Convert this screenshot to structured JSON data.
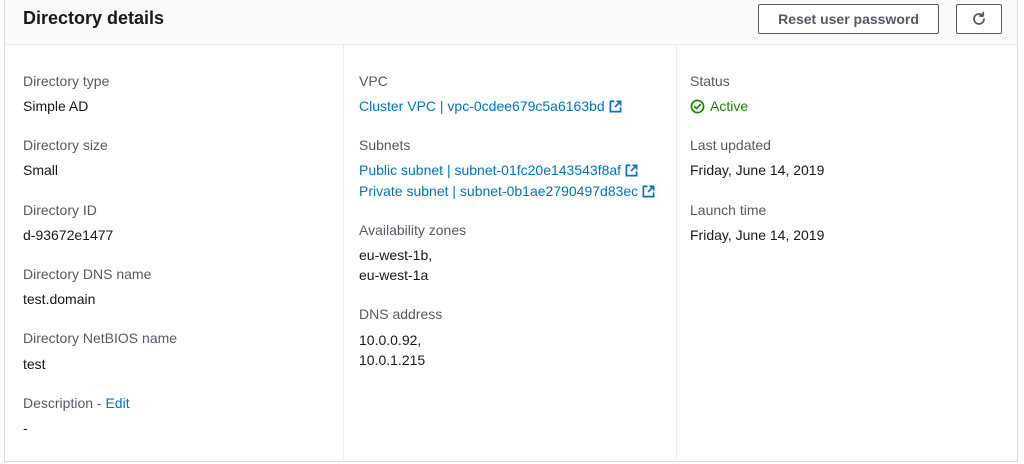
{
  "header": {
    "title": "Directory details",
    "reset_label": "Reset user password",
    "refresh_icon": "refresh-icon"
  },
  "col1": {
    "type_label": "Directory type",
    "type_value": "Simple AD",
    "size_label": "Directory size",
    "size_value": "Small",
    "id_label": "Directory ID",
    "id_value": "d-93672e1477",
    "dns_name_label": "Directory DNS name",
    "dns_name_value": "test.domain",
    "netbios_label": "Directory NetBIOS name",
    "netbios_value": "test",
    "description_label": "Description - ",
    "description_edit": "Edit",
    "description_value": "-"
  },
  "col2": {
    "vpc_label": "VPC",
    "vpc_link": "Cluster VPC | vpc-0cdee679c5a6163bd",
    "subnets_label": "Subnets",
    "subnet_public": "Public subnet | subnet-01fc20e143543f8af",
    "subnet_private": "Private subnet | subnet-0b1ae2790497d83ec",
    "az_label": "Availability zones",
    "az_line1": "eu-west-1b,",
    "az_line2": "eu-west-1a",
    "dns_label": "DNS address",
    "dns_line1": "10.0.0.92,",
    "dns_line2": "10.0.1.215"
  },
  "col3": {
    "status_label": "Status",
    "status_value": "Active",
    "updated_label": "Last updated",
    "updated_value": "Friday, June 14, 2019",
    "launch_label": "Launch time",
    "launch_value": "Friday, June 14, 2019"
  },
  "colors": {
    "link": "#0073bb",
    "success": "#1d8102",
    "label": "#545b64",
    "text": "#16191f"
  }
}
